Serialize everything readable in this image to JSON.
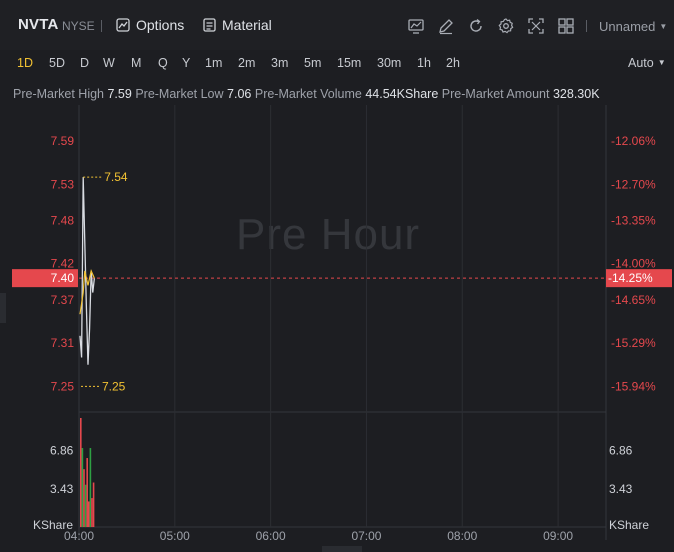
{
  "header": {
    "symbol": "NVTA",
    "exchange": "NYSE",
    "options_label": "Options",
    "material_label": "Material",
    "layout_name": "Unnamed",
    "icons": [
      "chart-style-icon",
      "draw-icon",
      "reset-icon",
      "settings-icon",
      "fullscreen-icon",
      "layout-grid-icon"
    ]
  },
  "timeframes": {
    "items": [
      "1D",
      "5D",
      "D",
      "W",
      "M",
      "Q",
      "Y",
      "1m",
      "2m",
      "3m",
      "5m",
      "15m",
      "30m",
      "1h",
      "2h"
    ],
    "active": "1D",
    "auto_label": "Auto"
  },
  "info": {
    "high_label": "Pre-Market High",
    "high_value": "7.59",
    "low_label": "Pre-Market Low",
    "low_value": "7.06",
    "volume_label": "Pre-Market Volume",
    "volume_value": "44.54KShare",
    "amount_label": "Pre-Market Amount",
    "amount_value": "328.30K"
  },
  "watermark": "Pre Hour",
  "colors": {
    "up": "#2ea043",
    "down": "#e5484d",
    "accent": "#f2c233",
    "price_label": "#e5484d",
    "line": "#d9dce2",
    "avg": "#f2c233"
  },
  "chart_data": {
    "type": "line",
    "x_ticks": [
      "04:00",
      "05:00",
      "06:00",
      "07:00",
      "08:00",
      "09:00"
    ],
    "x_range_minutes": [
      0,
      330
    ],
    "price_ticks": [
      "7.59",
      "7.53",
      "7.48",
      "7.42",
      "7.37",
      "7.31",
      "7.25"
    ],
    "percent_ticks": [
      "-12.06%",
      "-12.70%",
      "-13.35%",
      "-14.00%",
      "-14.65%",
      "-15.29%",
      "-15.94%"
    ],
    "ylim": [
      7.22,
      7.64
    ],
    "current_price": "7.40",
    "current_percent": "-14.25%",
    "max_annotation": "7.54",
    "min_annotation": "7.25",
    "series": [
      {
        "kind": "price",
        "x": [
          0,
          1,
          2,
          3,
          4,
          5,
          6,
          7,
          8,
          9
        ],
        "values": [
          7.32,
          7.29,
          7.54,
          7.45,
          7.36,
          7.28,
          7.33,
          7.41,
          7.38,
          7.4
        ]
      },
      {
        "kind": "average",
        "x": [
          0,
          2,
          3,
          5,
          7,
          9
        ],
        "values": [
          7.35,
          7.38,
          7.41,
          7.39,
          7.41,
          7.4
        ]
      }
    ],
    "volume": {
      "unit": "KShare",
      "ticks": [
        "6.86",
        "3.43"
      ],
      "max": 9.8,
      "x": [
        0,
        1,
        2,
        3,
        4,
        5,
        6,
        7,
        8
      ],
      "values": [
        9.8,
        7.1,
        5.2,
        3.8,
        6.2,
        2.3,
        7.1,
        2.6,
        4.0
      ],
      "direction": [
        "down",
        "up",
        "down",
        "up",
        "down",
        "down",
        "up",
        "down",
        "down"
      ]
    }
  }
}
